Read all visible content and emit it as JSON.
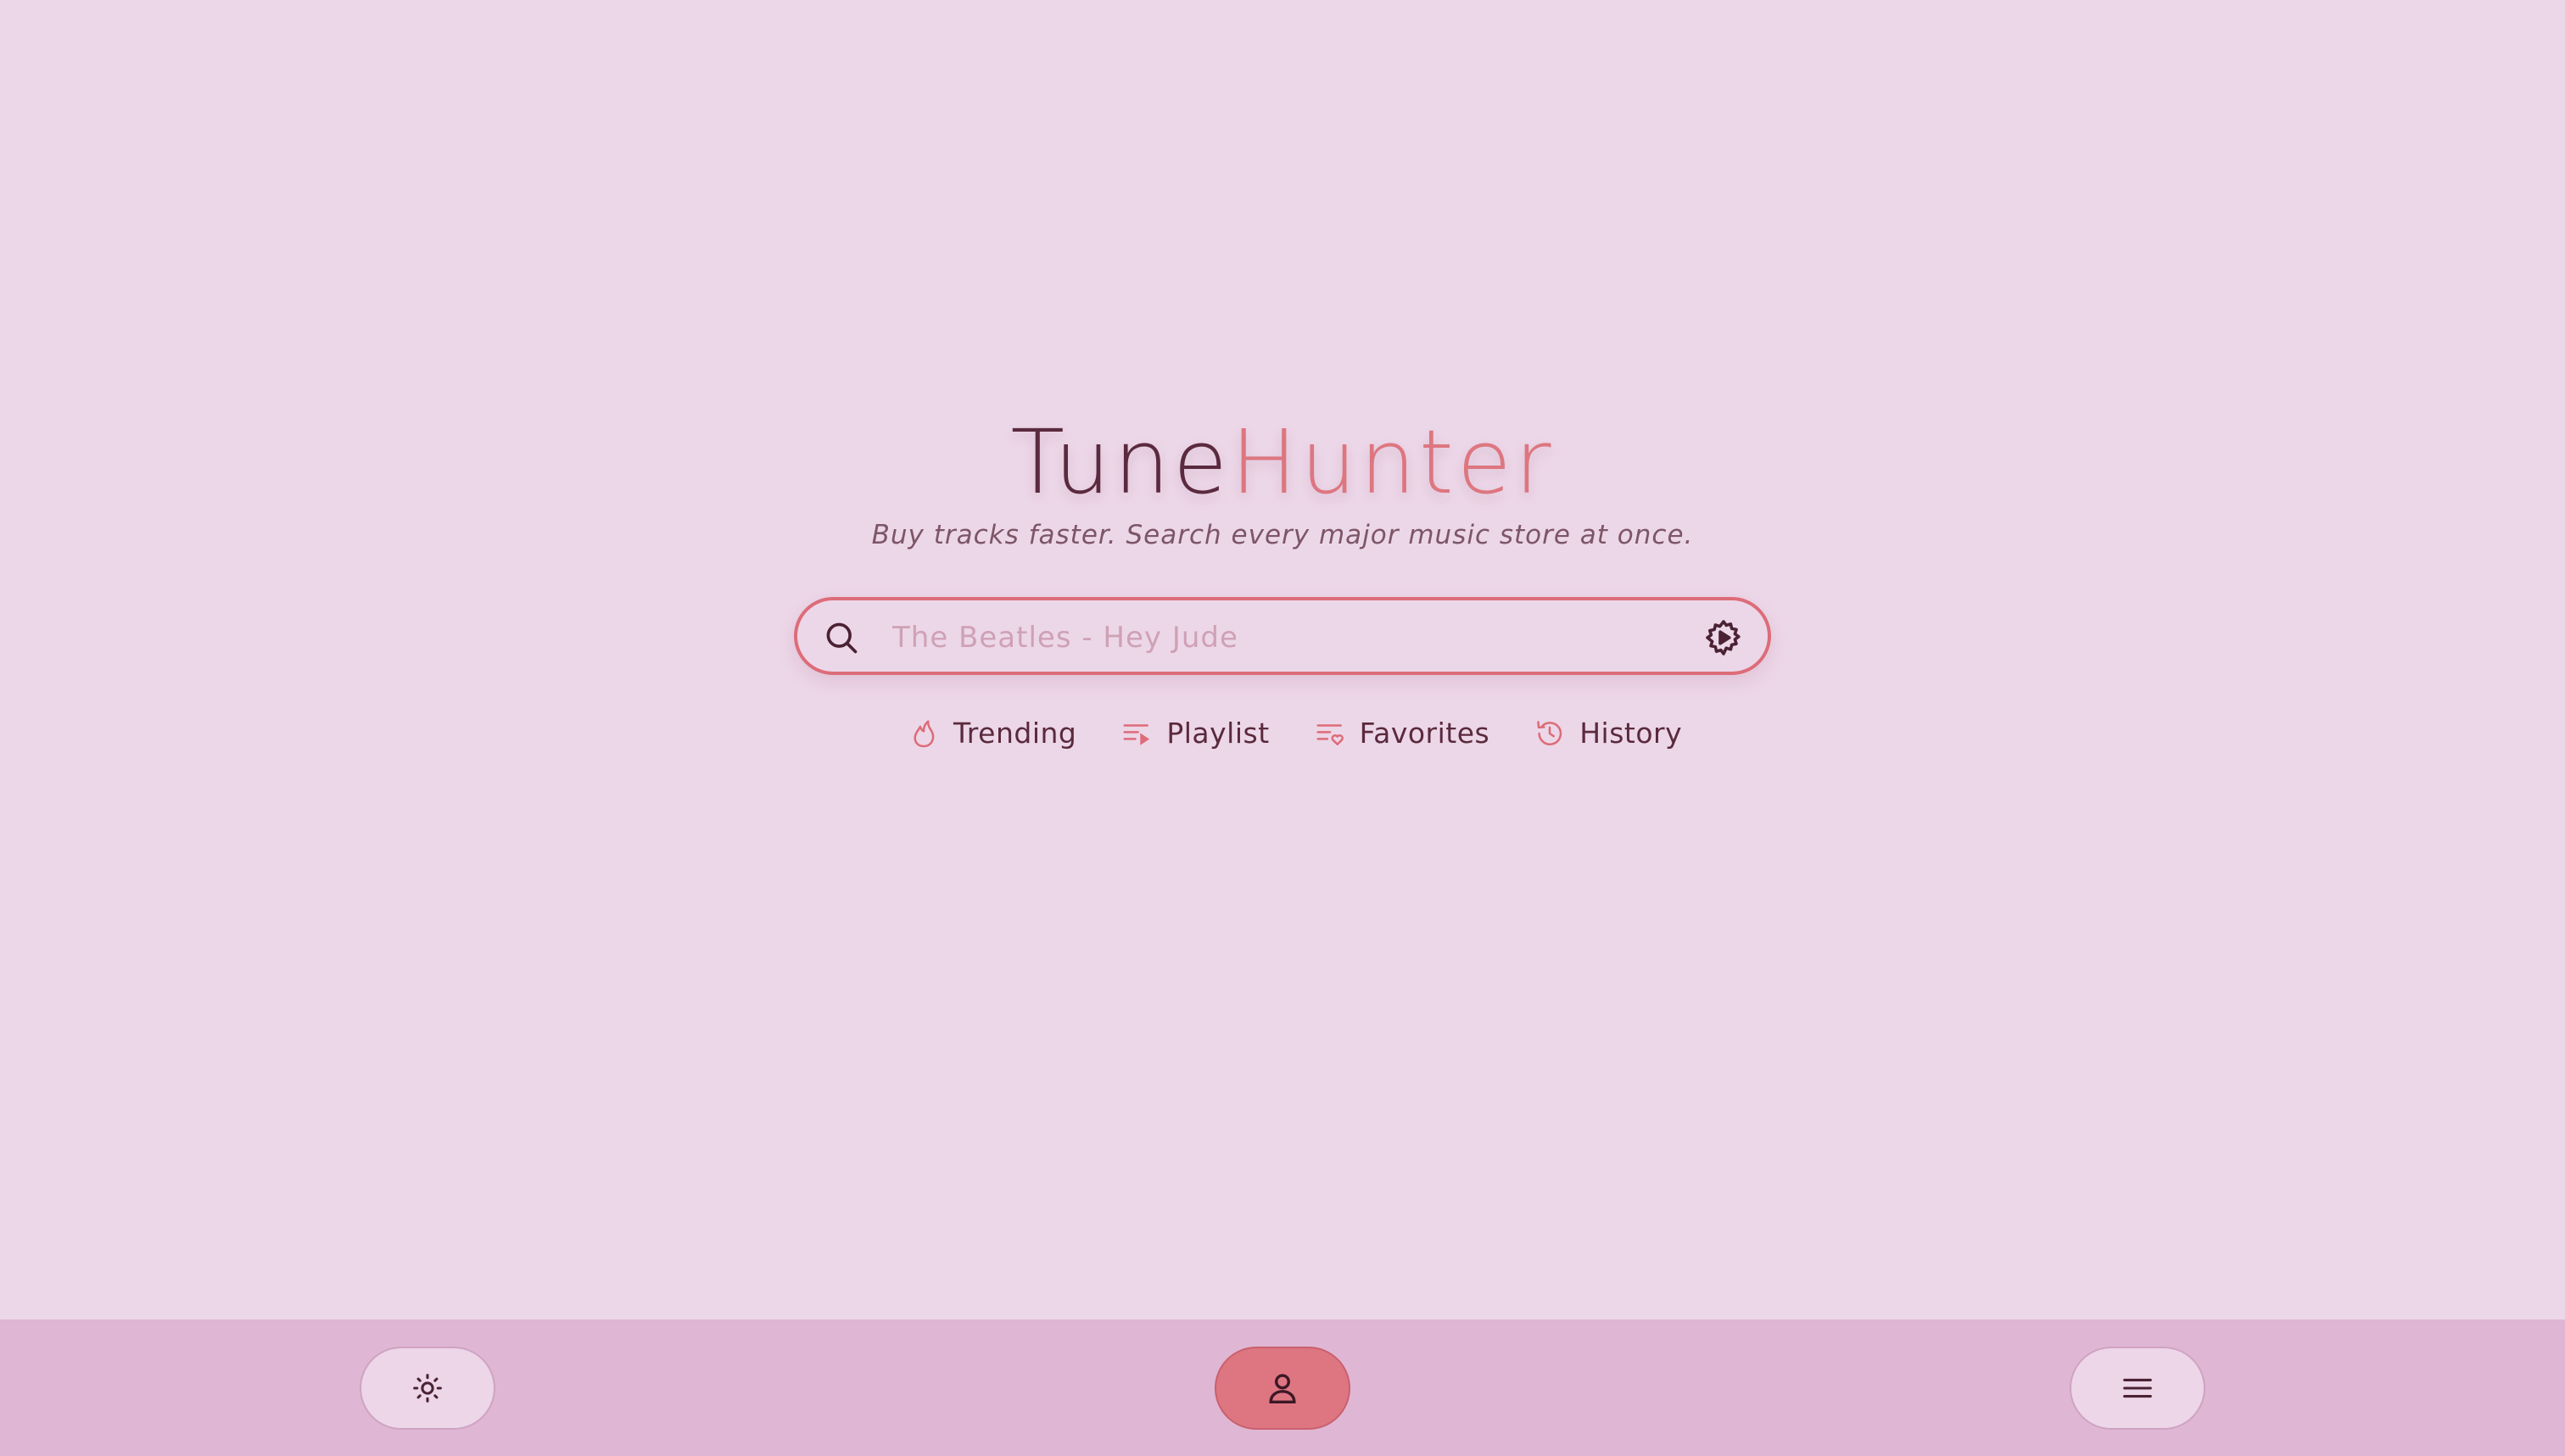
{
  "app": {
    "logo_part1": "Tune",
    "logo_part2": "Hunter",
    "tagline": "Buy tracks faster. Search every major music store at once."
  },
  "search": {
    "placeholder": "The Beatles - Hey Jude",
    "value": "",
    "left_icon": "search-icon",
    "right_icon": "settings-icon"
  },
  "quick_links": [
    {
      "label": "Trending",
      "icon": "flame-icon"
    },
    {
      "label": "Playlist",
      "icon": "playlist-icon"
    },
    {
      "label": "Favorites",
      "icon": "favorites-list-icon"
    },
    {
      "label": "History",
      "icon": "history-icon"
    }
  ],
  "bottom_nav": {
    "left_icon": "sun-icon",
    "center_icon": "user-icon",
    "right_icon": "menu-icon"
  },
  "colors": {
    "background": "#ecd7e8",
    "bottom_bar": "#dfb6d3",
    "accent": "#dd6c79",
    "text_dark": "#5b2a3e",
    "placeholder": "#cfa1b5"
  }
}
